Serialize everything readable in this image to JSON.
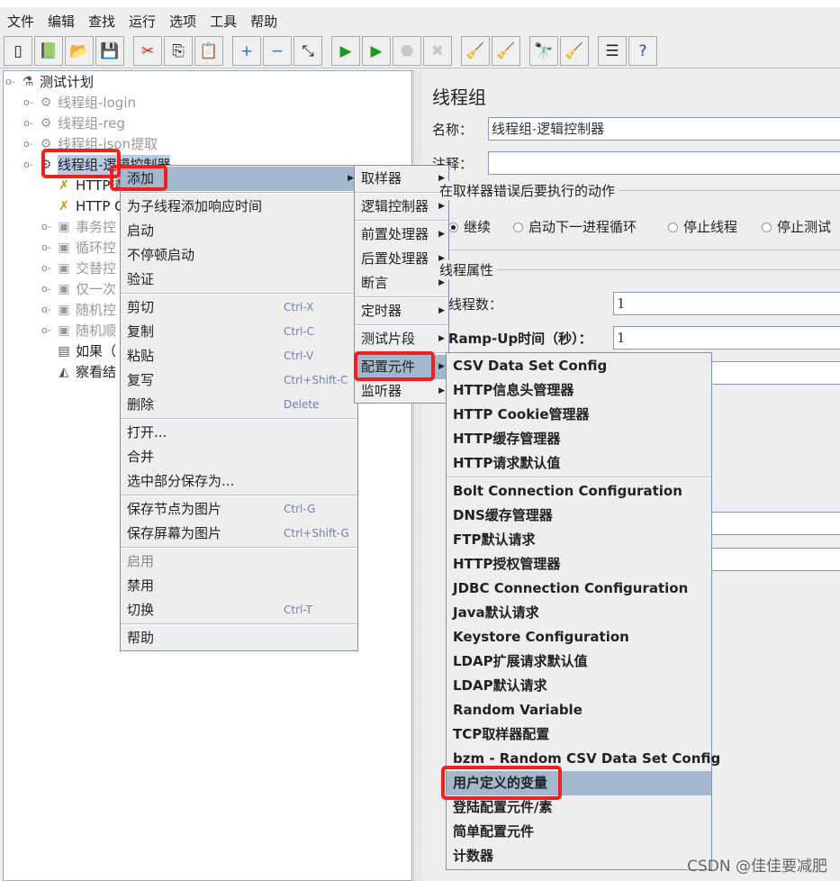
{
  "menubar": [
    "文件",
    "编辑",
    "查找",
    "运行",
    "选项",
    "工具",
    "帮助"
  ],
  "toolbar": [
    {
      "icon": "new-icon",
      "glyph": "▯"
    },
    {
      "icon": "templates-icon",
      "glyph": "📗"
    },
    {
      "icon": "open-icon",
      "glyph": "📂"
    },
    {
      "icon": "save-icon",
      "glyph": "💾"
    },
    {
      "icon": "cut-icon",
      "glyph": "✂"
    },
    {
      "icon": "copy-icon",
      "glyph": "⎘"
    },
    {
      "icon": "paste-icon",
      "glyph": "📋"
    },
    {
      "icon": "expand-icon",
      "glyph": "+"
    },
    {
      "icon": "collapse-icon",
      "glyph": "−"
    },
    {
      "icon": "toggle-icon",
      "glyph": "⤡"
    },
    {
      "icon": "start-icon",
      "glyph": "▶"
    },
    {
      "icon": "start-no-pause-icon",
      "glyph": "▶"
    },
    {
      "icon": "stop-icon",
      "glyph": "⬣"
    },
    {
      "icon": "shutdown-icon",
      "glyph": "✖"
    },
    {
      "icon": "clear-icon",
      "glyph": "🧹"
    },
    {
      "icon": "clear-all-icon",
      "glyph": "🧹"
    },
    {
      "icon": "search-icon",
      "glyph": "🔭"
    },
    {
      "icon": "reset-search-icon",
      "glyph": "🧹"
    },
    {
      "icon": "function-helper-icon",
      "glyph": "☰"
    },
    {
      "icon": "help-icon",
      "glyph": "?"
    }
  ],
  "tree": [
    {
      "label": "测试计划",
      "icon": "flask-icon",
      "level": 0,
      "disabled": false
    },
    {
      "label": "线程组-login",
      "icon": "gear-icon",
      "level": 1,
      "disabled": true
    },
    {
      "label": "线程组-reg",
      "icon": "gear-icon",
      "level": 1,
      "disabled": true
    },
    {
      "label": "线程组-json提取",
      "icon": "gear-icon",
      "level": 1,
      "disabled": true
    },
    {
      "label": "线程组-逻辑控制器",
      "icon": "gear-icon",
      "level": 1,
      "disabled": false,
      "selected": true
    },
    {
      "label": "HTTP请",
      "icon": "wrench-icon",
      "level": 2,
      "disabled": false
    },
    {
      "label": "HTTP C",
      "icon": "wrench-icon",
      "level": 2,
      "disabled": false
    },
    {
      "label": "事务控",
      "icon": "controller-icon",
      "level": 2,
      "disabled": true
    },
    {
      "label": "循环控",
      "icon": "controller-icon",
      "level": 2,
      "disabled": true
    },
    {
      "label": "交替控",
      "icon": "controller-icon",
      "level": 2,
      "disabled": true
    },
    {
      "label": "仅一次",
      "icon": "controller-icon",
      "level": 2,
      "disabled": true
    },
    {
      "label": "随机控",
      "icon": "controller-icon",
      "level": 2,
      "disabled": true
    },
    {
      "label": "随机顺",
      "icon": "controller-icon",
      "level": 2,
      "disabled": true
    },
    {
      "label": "如果（",
      "icon": "if-icon",
      "level": 2,
      "disabled": false
    },
    {
      "label": "察看结",
      "icon": "graph-icon",
      "level": 2,
      "disabled": false
    }
  ],
  "panel": {
    "title": "线程组",
    "name_label": "名称：",
    "name_value": "线程组-逻辑控制器",
    "comment_label": "注释：",
    "comment_value": "",
    "error_section": "在取样器错误后要执行的动作",
    "radios": [
      {
        "label": "继续",
        "checked": true
      },
      {
        "label": "启动下一进程循环",
        "checked": false
      },
      {
        "label": "停止线程",
        "checked": false
      },
      {
        "label": "停止测试",
        "checked": false
      }
    ],
    "props_section": "线程属性",
    "threads_label": "线程数：",
    "threads_value": "1",
    "rampup_label": "Ramp-Up时间（秒）：",
    "rampup_value": "1"
  },
  "context_menu": [
    {
      "label": "添加",
      "submenu": true,
      "highlighted": true
    },
    {
      "sep": true
    },
    {
      "label": "为子线程添加响应时间"
    },
    {
      "label": "启动"
    },
    {
      "label": "不停顿启动"
    },
    {
      "label": "验证"
    },
    {
      "sep": true
    },
    {
      "label": "剪切",
      "shortcut": "Ctrl-X"
    },
    {
      "label": "复制",
      "shortcut": "Ctrl-C"
    },
    {
      "label": "粘贴",
      "shortcut": "Ctrl-V"
    },
    {
      "label": "复写",
      "shortcut": "Ctrl+Shift-C"
    },
    {
      "label": "删除",
      "shortcut": "Delete"
    },
    {
      "sep": true
    },
    {
      "label": "打开..."
    },
    {
      "label": "合并"
    },
    {
      "label": "选中部分保存为..."
    },
    {
      "sep": true
    },
    {
      "label": "保存节点为图片",
      "shortcut": "Ctrl-G"
    },
    {
      "label": "保存屏幕为图片",
      "shortcut": "Ctrl+Shift-G"
    },
    {
      "sep": true
    },
    {
      "label": "启用",
      "disabled": true
    },
    {
      "label": "禁用"
    },
    {
      "label": "切换",
      "shortcut": "Ctrl-T"
    },
    {
      "sep": true
    },
    {
      "label": "帮助"
    }
  ],
  "add_menu": [
    {
      "label": "取样器",
      "submenu": true
    },
    {
      "sep": true
    },
    {
      "label": "逻辑控制器",
      "submenu": true
    },
    {
      "sep": true
    },
    {
      "label": "前置处理器",
      "submenu": true
    },
    {
      "label": "后置处理器",
      "submenu": true
    },
    {
      "label": "断言",
      "submenu": true
    },
    {
      "sep": true
    },
    {
      "label": "定时器",
      "submenu": true
    },
    {
      "sep": true
    },
    {
      "label": "测试片段",
      "submenu": true
    },
    {
      "sep": true
    },
    {
      "label": "配置元件",
      "submenu": true,
      "highlighted": true
    },
    {
      "label": "监听器",
      "submenu": true
    }
  ],
  "config_menu": [
    {
      "label": "CSV Data Set Config"
    },
    {
      "label": "HTTP信息头管理器"
    },
    {
      "label": "HTTP Cookie管理器"
    },
    {
      "label": "HTTP缓存管理器"
    },
    {
      "label": "HTTP请求默认值"
    },
    {
      "sep": true
    },
    {
      "label": "Bolt Connection Configuration"
    },
    {
      "label": "DNS缓存管理器"
    },
    {
      "label": "FTP默认请求"
    },
    {
      "label": "HTTP授权管理器"
    },
    {
      "label": "JDBC Connection Configuration"
    },
    {
      "label": "Java默认请求"
    },
    {
      "label": "Keystore Configuration"
    },
    {
      "label": "LDAP扩展请求默认值"
    },
    {
      "label": "LDAP默认请求"
    },
    {
      "label": "Random Variable"
    },
    {
      "label": "TCP取样器配置"
    },
    {
      "label": "bzm - Random CSV Data Set Config"
    },
    {
      "label": "用户定义的变量",
      "highlighted": true
    },
    {
      "label": "登陆配置元件/素"
    },
    {
      "label": "简单配置元件"
    },
    {
      "label": "计数器"
    }
  ],
  "watermark": "CSDN @佳佳要减肥"
}
